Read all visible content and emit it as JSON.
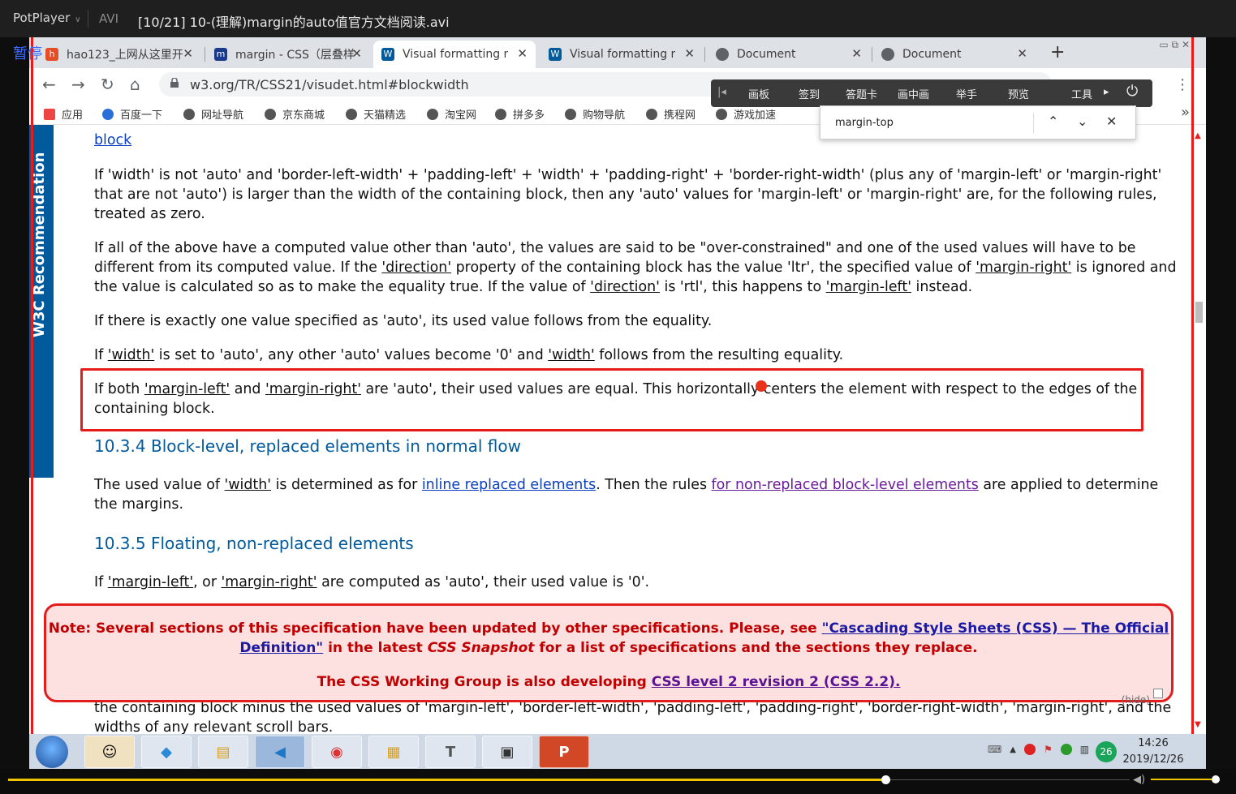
{
  "player": {
    "app_name": "PotPlayer",
    "format": "AVI",
    "file_title": "[10/21] 10-(理解)margin的auto值官方文档阅读.avi",
    "pause_label": "暂停",
    "seek_progress": 0.71,
    "volume_level": 0.99
  },
  "browser": {
    "tabs": [
      {
        "label": "hao123_上网从这里开",
        "icon": "hao123-icon",
        "color": "#e44d26"
      },
      {
        "label": "margin - CSS（层叠样",
        "icon": "mdn-icon",
        "color": "#1a3b8b"
      },
      {
        "label": "Visual formatting m",
        "icon": "w3c-icon",
        "color": "#005a9c"
      },
      {
        "label": "Visual formatting m",
        "icon": "w3c-icon",
        "color": "#005a9c"
      },
      {
        "label": "Document",
        "icon": "globe-icon",
        "color": "#5f6368"
      },
      {
        "label": "Document",
        "icon": "globe-icon",
        "color": "#5f6368"
      }
    ],
    "active_tab_index": 2,
    "url": "w3.org/TR/CSS21/visudet.html#blockwidth",
    "bookmarks": [
      {
        "label": "应用"
      },
      {
        "label": "百度一下"
      },
      {
        "label": "网址导航"
      },
      {
        "label": "京东商城"
      },
      {
        "label": "天猫精选"
      },
      {
        "label": "淘宝网"
      },
      {
        "label": "拼多多"
      },
      {
        "label": "购物导航"
      },
      {
        "label": "携程网"
      },
      {
        "label": "游戏加速"
      }
    ],
    "find_query": "margin-top"
  },
  "overlay_toolbar": {
    "items": [
      "画板",
      "签到",
      "答题卡",
      "画中画",
      "举手",
      "预览",
      "工具"
    ]
  },
  "page": {
    "side_label": "W3C Recommendation",
    "top_fragment": "block",
    "p1": "If 'width' is not 'auto' and 'border-left-width' + 'padding-left' + 'width' + 'padding-right' + 'border-right-width' (plus any of 'margin-left' or 'margin-right' that are not 'auto') is larger than the width of the containing block, then any 'auto' values for 'margin-left' or 'margin-right' are, for the following rules, treated as zero.",
    "p2a": "If all of the above have a computed value other than 'auto', the values are said to be \"over-constrained\" and one of the used values will have to be different from its computed value. If the ",
    "p2_link1": "'direction'",
    "p2b": " property of the containing block has the value 'ltr', the specified value of ",
    "p2_link2": "'margin-right'",
    "p2c": " is ignored and the value is calculated so as to make the equality true. If the value of ",
    "p2_link3": "'direction'",
    "p2d": " is 'rtl', this happens to ",
    "p2_link4": "'margin-left'",
    "p2e": " instead.",
    "p3": "If there is exactly one value specified as 'auto', its used value follows from the equality.",
    "p4a": "If ",
    "p4_link1": "'width'",
    "p4b": " is set to 'auto', any other 'auto' values become '0' and ",
    "p4_link2": "'width'",
    "p4c": " follows from the resulting equality.",
    "p5a": "If both ",
    "p5_link1": "'margin-left'",
    "p5b": " and ",
    "p5_link2": "'margin-right'",
    "p5c": " are 'auto', their used values are equal. This horizontally centers the element with respect to the edges of the containing block.",
    "h_1034": "10.3.4 Block-level, replaced elements in normal flow",
    "p6a": "The used value of ",
    "p6_link1": "'width'",
    "p6b": " is determined as for ",
    "p6_link2": "inline replaced elements",
    "p6c": ". Then the rules ",
    "p6_link3": "for non-replaced block-level elements",
    "p6d": " are applied to determine the margins.",
    "h_1035": "10.3.5 Floating, non-replaced elements",
    "p7a": "If ",
    "p7_link1": "'margin-left'",
    "p7b": ", or ",
    "p7_link2": "'margin-right'",
    "p7c": " are computed as 'auto', their used value is '0'.",
    "under_note": "the containing block minus the used values of 'margin-left', 'border-left-width', 'padding-left', 'padding-right', 'border-right-width', 'margin-right', and the widths of any relevant scroll bars."
  },
  "note": {
    "l1a": "Note: Several sections of this specification have been updated by other specifications. Please, see ",
    "l1_link": "\"Cascading Style Sheets (CSS) — The Official",
    "l2_link": "Definition\"",
    "l2a": " in the latest ",
    "l2_em": "CSS Snapshot",
    "l2b": " for a list of specifications and the sections they replace.",
    "l3a": "The CSS Working Group is also developing ",
    "l3_link": "CSS level 2 revision 2 (CSS 2.2).",
    "hide_label": "(hide)"
  },
  "taskbar": {
    "apps": [
      "avatar-app",
      "baidu-netdisk-app",
      "file-explorer-app",
      "vscode-app",
      "chrome-app",
      "notepad-app",
      "typora-app",
      "terminal-app",
      "powerpoint-app"
    ],
    "time": "14:26",
    "date": "2019/12/26",
    "badge": "26"
  },
  "colors": {
    "w3c_blue": "#005a9c",
    "highlight_red": "#e81b1b",
    "seek_yellow": "#f0c400"
  }
}
